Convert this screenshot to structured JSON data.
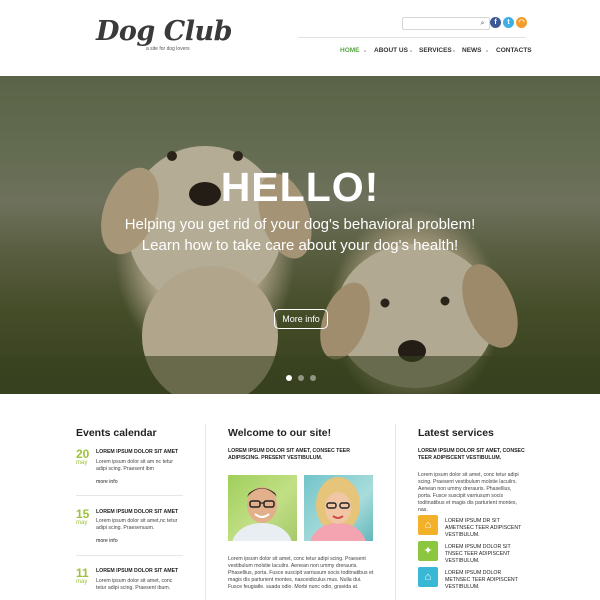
{
  "header": {
    "logo": "Dog Club",
    "tagline": "a site for dog lovers",
    "search": {
      "placeholder": "",
      "value": ""
    },
    "icons": {
      "search": "search-icon",
      "facebook": "facebook-icon",
      "twitter": "twitter-icon",
      "rss": "rss-icon"
    },
    "nav": [
      {
        "label": "HOME",
        "active": true
      },
      {
        "label": "ABOUT US"
      },
      {
        "label": "SERVICES"
      },
      {
        "label": "NEWS"
      },
      {
        "label": "CONTACTS"
      }
    ]
  },
  "hero": {
    "title": "HELLO!",
    "subtitle_line1": "Helping you get rid of your dog's behavioral problem!",
    "subtitle_line2": "Learn how to take care about your dog's health!",
    "button": "More info",
    "slides": 3,
    "active_slide": 1
  },
  "events": {
    "title": "Events calendar",
    "items": [
      {
        "day": "20",
        "month": "may",
        "title": "LOREM IPSUM DOLOR SIT AMET",
        "text": "Lorem ipsum dolor sit am nc tetur adipi scing. Praesent ibm",
        "more": "more info"
      },
      {
        "day": "15",
        "month": "may",
        "title": "LOREM IPSUM DOLOR SIT AMET",
        "text": "Lorem ipsum dolor sit amet,nc tetur adipi scing. Praesenuum.",
        "more": "more info"
      },
      {
        "day": "11",
        "month": "may",
        "title": "LOREM IPSUM DOLOR SIT AMET",
        "text": "Lorem ipsum dolor sit amet, conc tetur adipi scing. Praesent ibum."
      }
    ]
  },
  "welcome": {
    "title": "Welcome to our site!",
    "heading": "LOREM IPSUM DOLOR SIT AMET, CONSEC TEER ADIPISCING. PRESENT VESTIBULUM.",
    "text": "Lorem ipsum dolor sit amet, conc tetur adipi scing. Praesent vestibulum molstie lacuilrs. Aenean non ummy drerauris. Phasellius, porta. Fusce suscipit varriusum socis toditnatibus et magis dis parturient montes, nasceidiculus mus. Nulla dui. Fusce feugiatle. suada odio. Morbi nunc odio, gravida at."
  },
  "services": {
    "title": "Latest services",
    "heading": "LOREM IPSUM DOLOR SIT AMET, CONSEC TEER ADIPISCENT VESTIBULUM.",
    "intro": "Lorem ipsum dolor sit amet, conc tetur adipi scing. Praesent vestibulum molstie lacuilrs. Aenean non ummy drerauris. Phasellius, porta. Fusce suscipit varriusum socis toditnatibus et magis dis parturient montes, nas.",
    "items": [
      {
        "icon": "dog-house-icon",
        "color": "#f3b12a",
        "text": "LOREM IPSUM DR SIT AMETNSEC TEER ADIPISCENT VESTIBULUM."
      },
      {
        "icon": "bone-icon",
        "color": "#8cc63f",
        "text": "LOREM IPSUM DOLOR SIT TNSEC TEER ADIPISCENT VESTIBULUM."
      },
      {
        "icon": "pet-house-icon",
        "color": "#39b8d6",
        "text": "LOREM IPSUM DOLOR METNSEC TEER ADIPISCENT VESTIBULUM."
      }
    ]
  },
  "colors": {
    "accent_green": "#5aa645",
    "date_green": "#9cc23a"
  }
}
